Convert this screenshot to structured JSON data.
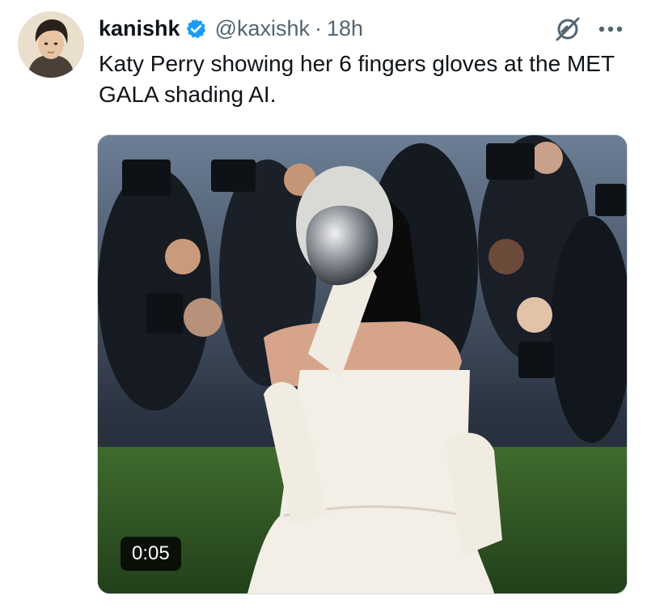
{
  "tweet": {
    "author": {
      "display_name": "kanishk",
      "handle": "@kaxishk",
      "verified": true
    },
    "separator": "·",
    "time": "18h",
    "text": "Katy Perry showing her 6 fingers gloves at the MET GALA shading AI.",
    "media": {
      "type": "video",
      "duration": "0:05"
    },
    "icons": {
      "verified": "verified-badge-icon",
      "grok": "grok-icon",
      "more": "more-icon"
    },
    "colors": {
      "verified": "#1d9bf0",
      "secondary_text": "#536471"
    }
  }
}
